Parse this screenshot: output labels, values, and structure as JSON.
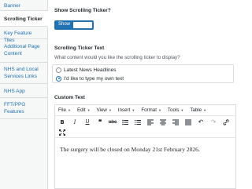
{
  "sidebar": {
    "items": [
      {
        "label": "Banner"
      },
      {
        "label": "Scrolling Ticker"
      },
      {
        "label": "Key Feature Tiles"
      },
      {
        "label": "Additional Page Content"
      },
      {
        "label": "NHS and Local Services Links"
      },
      {
        "label": "NHS App"
      },
      {
        "label": "FFT/PPG Features"
      }
    ]
  },
  "ticker_toggle": {
    "label": "Show Scrolling Ticker?",
    "state_text": "Show",
    "on": true
  },
  "ticker_text": {
    "label": "Scrolling Ticker Text",
    "description": "What content would you like the scrolling ticker to display?",
    "options": [
      {
        "label": "Latest News Headlines",
        "selected": false
      },
      {
        "label": "I'd like to type my own text",
        "selected": true
      }
    ]
  },
  "custom_text": {
    "label": "Custom Text",
    "menus": [
      "File",
      "Edit",
      "View",
      "Insert",
      "Format",
      "Tools",
      "Table"
    ],
    "content": "The surgery will be closed on Monday 21st February 2026."
  },
  "colors": {
    "accent": "#2271b1",
    "link": "#2271b1",
    "sidebar_bg": "#f6f7f7",
    "border": "#dcdcde"
  }
}
